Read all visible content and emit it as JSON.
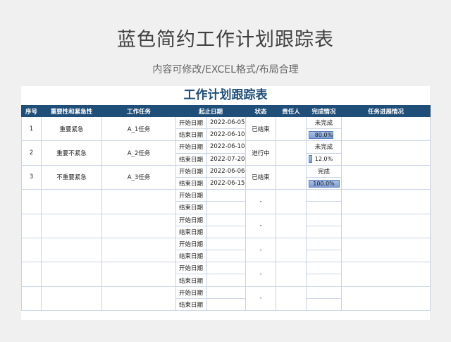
{
  "header": {
    "title": "蓝色简约工作计划跟踪表",
    "subtitle": "内容可修改/EXCEL格式/布局合理"
  },
  "sheet": {
    "title": "工作计划跟踪表",
    "columns": [
      "序号",
      "重要性和紧急性",
      "工作任务",
      "起止日期",
      "状态",
      "责任人",
      "完成情况",
      "任务进展情况"
    ],
    "start_label": "开始日期",
    "end_label": "结束日期",
    "empty_status": "-",
    "rows": [
      {
        "no": "1",
        "priority": "重要紧急",
        "task": "A_1任务",
        "start": "2022-06-05",
        "end": "2022-06-10",
        "status": "已结束",
        "owner": "",
        "completion": "未完成",
        "progress": 0.8,
        "progress_label": "80.0%",
        "notes": ""
      },
      {
        "no": "2",
        "priority": "重要不紧急",
        "task": "A_2任务",
        "start": "2022-06-10",
        "end": "2022-07-20",
        "status": "进行中",
        "owner": "",
        "completion": "未完成",
        "progress": 0.12,
        "progress_label": "12.0%",
        "notes": ""
      },
      {
        "no": "3",
        "priority": "不重要紧急",
        "task": "A_3任务",
        "start": "2022-06-06",
        "end": "2022-06-15",
        "status": "已结束",
        "owner": "",
        "completion": "完成",
        "progress": 1.0,
        "progress_label": "100.0%",
        "notes": ""
      }
    ],
    "empty_row_count": 5
  }
}
